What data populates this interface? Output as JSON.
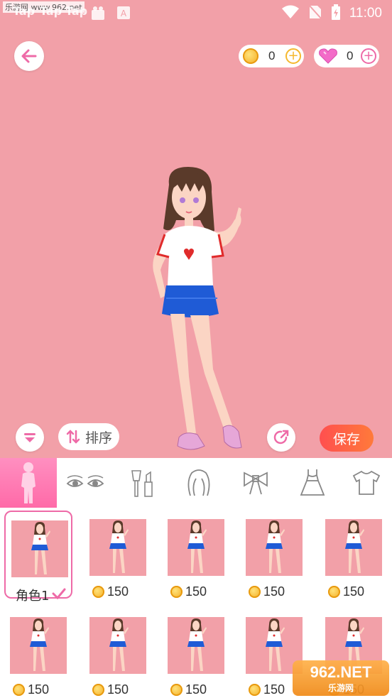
{
  "status_bar": {
    "watermark": "乐游网 www.962.net",
    "tap_labels": [
      "Tap",
      "Tap",
      "Tap"
    ],
    "time": "11:00",
    "icons": [
      "taptap-icon",
      "bag-icon",
      "a-icon",
      "wifi-icon",
      "no-sim-icon",
      "battery-icon"
    ]
  },
  "header": {
    "back_icon": "arrow-left-icon",
    "coins": "0",
    "gems": "0"
  },
  "controls": {
    "sort_label": "排序",
    "save_label": "保存"
  },
  "categories": [
    {
      "icon": "body-icon",
      "active": true
    },
    {
      "icon": "eyes-icon",
      "active": false
    },
    {
      "icon": "makeup-icon",
      "active": false
    },
    {
      "icon": "hair-icon",
      "active": false
    },
    {
      "icon": "bow-icon",
      "active": false
    },
    {
      "icon": "dress-icon",
      "active": false
    },
    {
      "icon": "tshirt-icon",
      "active": false
    }
  ],
  "items": [
    {
      "label": "角色1",
      "selected": true
    },
    {
      "price": "150"
    },
    {
      "price": "150"
    },
    {
      "price": "150"
    },
    {
      "price": "150"
    },
    {
      "price": "150"
    },
    {
      "price": "150"
    },
    {
      "price": "150"
    },
    {
      "price": "150"
    },
    {
      "price": "150"
    }
  ],
  "bottom_watermark": {
    "brand": "962.NET",
    "sub": "乐游网"
  },
  "colors": {
    "background": "#f2a0a8",
    "accent": "#ee6aa7",
    "save": "#ff5a45"
  }
}
